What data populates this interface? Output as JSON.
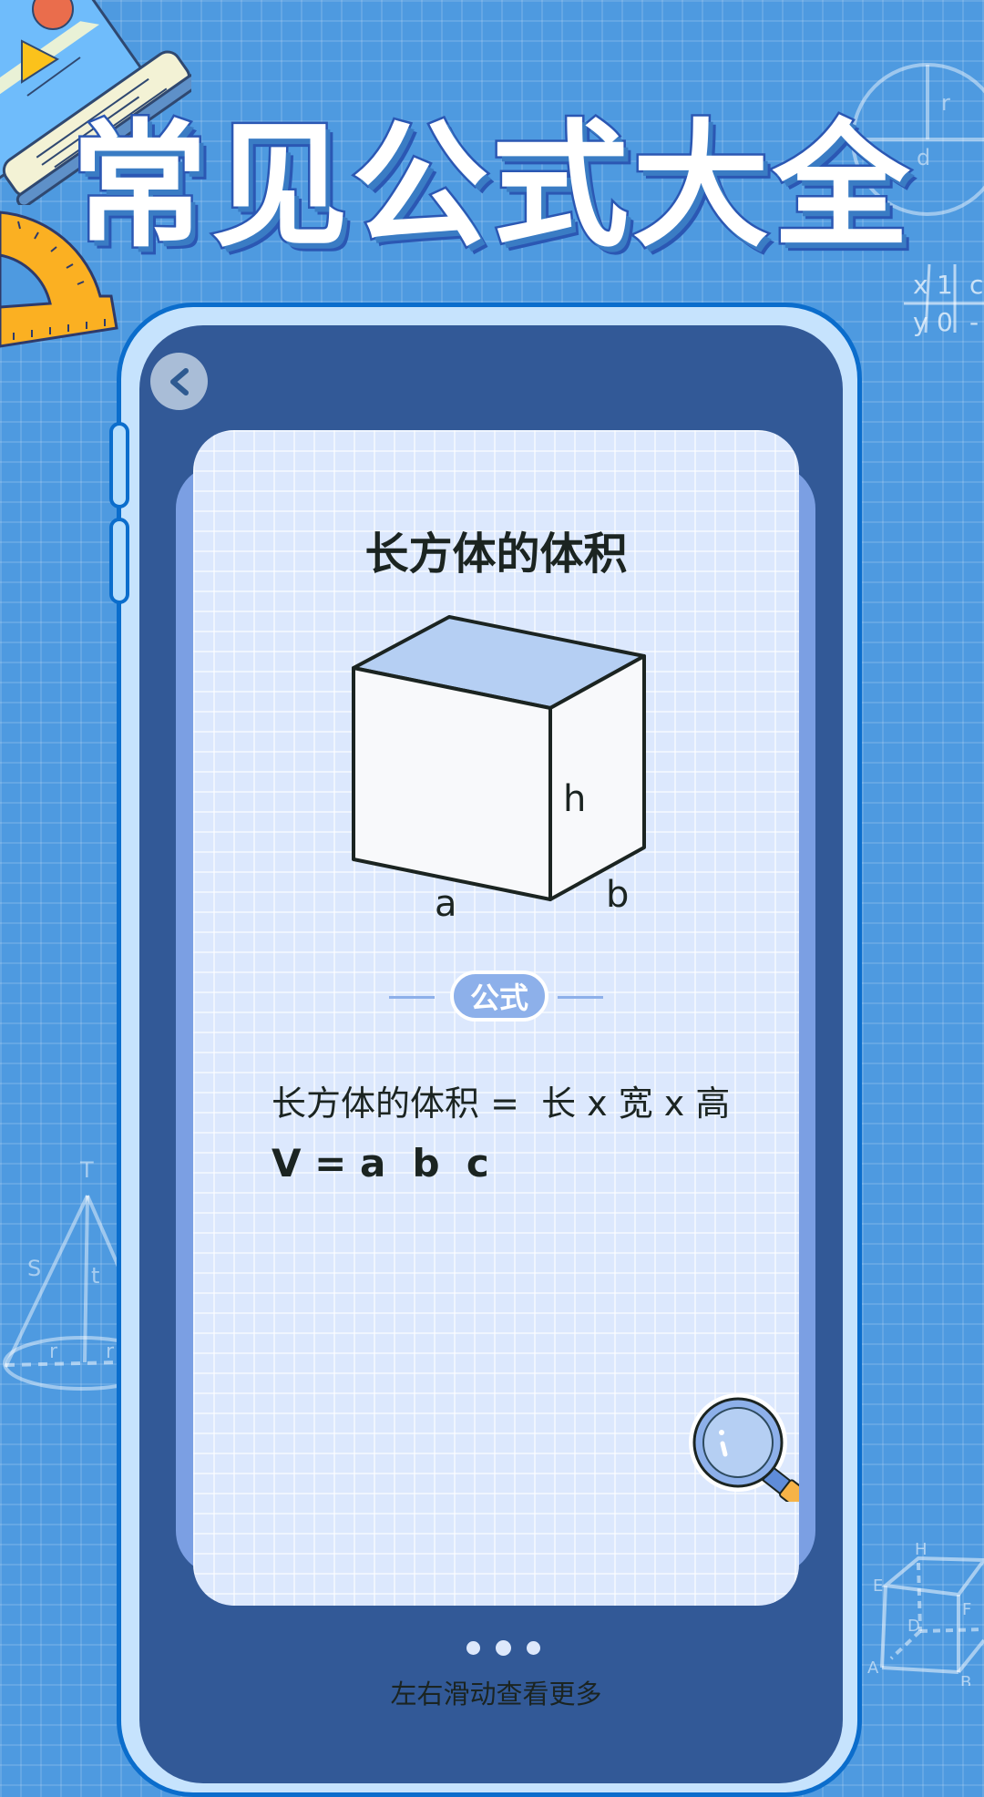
{
  "header": {
    "title": "常见公式大全"
  },
  "decorations": {
    "circle_labels": {
      "radius": "r",
      "diameter": "d"
    },
    "table_labels": {
      "row1": [
        "x",
        "1",
        "c"
      ],
      "row2": [
        "y",
        "0",
        "-"
      ]
    },
    "cone_labels": {
      "apex": "T",
      "slant": "S",
      "height": "t",
      "radius_left": "r",
      "radius_right": "r"
    },
    "cube_labels": [
      "H",
      "E",
      "F",
      "D",
      "A",
      "B"
    ]
  },
  "phone": {
    "back_button_label": "back",
    "card": {
      "title": "长方体的体积",
      "diagram_labels": {
        "height": "h",
        "length": "a",
        "width": "b"
      },
      "badge": "公式",
      "formula_words": "长方体的体积 =  长 x 宽 x 高",
      "formula_symbols": "V = a  b  c"
    },
    "pagination": {
      "total": 3,
      "current": 2
    },
    "hint": "左右滑动查看更多"
  },
  "colors": {
    "background": "#4e9ae0",
    "phone_frame": "#0b6dcc",
    "phone_bezel": "#c6e3fd",
    "screen": "#325997",
    "card": "#dce8fd",
    "card_back": "#7b9fe3",
    "accent": "#8db0ea",
    "cuboid_top": "#b5cff3",
    "text_dark": "#1b2421"
  }
}
